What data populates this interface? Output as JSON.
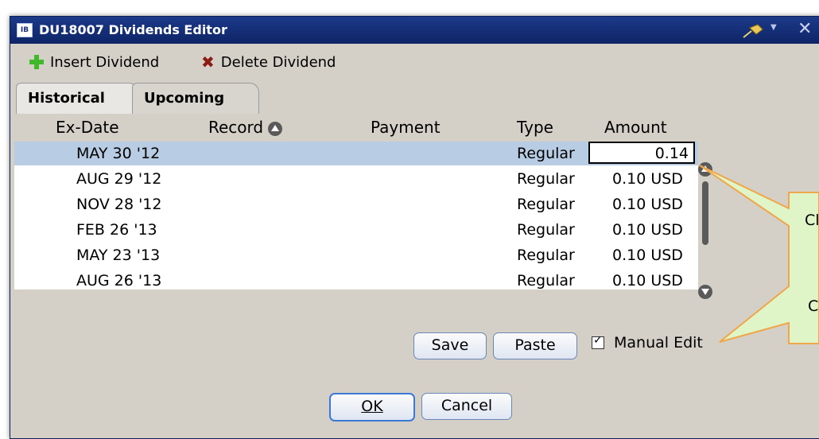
{
  "window": {
    "title": "DU18007 Dividends Editor",
    "logo": "IB"
  },
  "toolbar": {
    "insert_label": "Insert Dividend",
    "delete_label": "Delete Dividend"
  },
  "tabs": [
    {
      "label": "Historical"
    },
    {
      "label": "Upcoming"
    }
  ],
  "columns": {
    "ex_date": "Ex-Date",
    "record": "Record",
    "payment": "Payment",
    "type": "Type",
    "amount": "Amount"
  },
  "rows": [
    {
      "ex_date": "MAY 30 '12",
      "type": "Regular",
      "amount": "0.14"
    },
    {
      "ex_date": "AUG 29 '12",
      "type": "Regular",
      "amount": "0.10 USD"
    },
    {
      "ex_date": "NOV 28 '12",
      "type": "Regular",
      "amount": "0.10 USD"
    },
    {
      "ex_date": "FEB 26 '13",
      "type": "Regular",
      "amount": "0.10 USD"
    },
    {
      "ex_date": "MAY 23 '13",
      "type": "Regular",
      "amount": "0.10 USD"
    },
    {
      "ex_date": "AUG 26 '13",
      "type": "Regular",
      "amount": "0.10 USD"
    }
  ],
  "actions": {
    "save": "Save",
    "paste": "Paste",
    "manual_edit": "Manual Edit",
    "manual_edit_checked": true
  },
  "dialog_buttons": {
    "ok": "OK",
    "cancel": "Cancel"
  },
  "callout": {
    "line1": "Cl",
    "line2": "C"
  },
  "icons": [
    "app-logo-icon",
    "pin-icon",
    "close-icon",
    "plus-icon",
    "delete-x-icon",
    "sort-ascending-icon",
    "scroll-up-icon",
    "scroll-down-icon"
  ],
  "colors": {
    "titlebar": "#0e2465",
    "selected_row": "#b8cce4",
    "add_green": "#3fb82a",
    "delete_red": "#8a1b14",
    "callout_fill": "#dff5c8",
    "callout_border": "#f0a64a"
  }
}
